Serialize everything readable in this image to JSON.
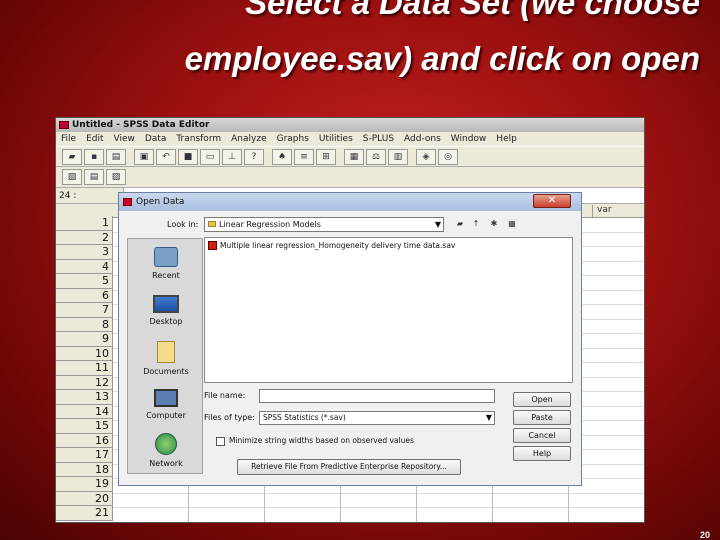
{
  "slide": {
    "title_line1": "Select a Data Set (we choose",
    "title_line2": "employee.sav) and click on open",
    "page_number": "20"
  },
  "spss": {
    "window_title": "Untitled - SPSS Data Editor",
    "menu": [
      "File",
      "Edit",
      "View",
      "Data",
      "Transform",
      "Analyze",
      "Graphs",
      "Utilities",
      "S-PLUS",
      "Add-ons",
      "Window",
      "Help"
    ],
    "cell_reference": "24 :",
    "var_header": "var",
    "row_numbers": [
      "1",
      "2",
      "3",
      "4",
      "5",
      "6",
      "7",
      "8",
      "9",
      "10",
      "11",
      "12",
      "13",
      "14",
      "15",
      "16",
      "17",
      "18",
      "19",
      "20",
      "21"
    ]
  },
  "dialog": {
    "title": "Open Data",
    "close_label": "✕",
    "look_in_label": "Look in:",
    "look_in_value": "Linear Regression Models",
    "places": [
      "Recent",
      "Desktop",
      "Documents",
      "Computer",
      "Network"
    ],
    "files": [
      "Multiple linear regression_Homogeneity delivery time data.sav"
    ],
    "file_name_label": "File name:",
    "file_name_value": "",
    "files_of_type_label": "Files of type:",
    "files_of_type_value": "SPSS Statistics (*.sav)",
    "minimize_label": "Minimize string widths based on observed values",
    "retrieve_label": "Retrieve File From Predictive Enterprise Repository...",
    "buttons": {
      "open": "Open",
      "paste": "Paste",
      "cancel": "Cancel",
      "help": "Help"
    }
  }
}
